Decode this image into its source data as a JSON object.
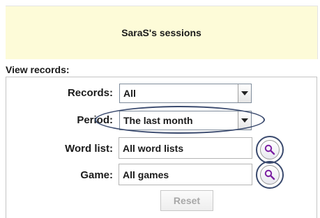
{
  "header": {
    "title": "SaraS's sessions"
  },
  "view_records": {
    "label": "View records:",
    "records": {
      "label": "Records:",
      "value": "All"
    },
    "period": {
      "label": "Period:",
      "value": "The last month"
    },
    "word_list": {
      "label": "Word list:",
      "value": "All word lists"
    },
    "game": {
      "label": "Game:",
      "value": "All games"
    },
    "reset_label": "Reset"
  },
  "icons": {
    "dropdown": "chevron-down-icon",
    "search": "magnifier-icon",
    "search_color": "#7b1fa2"
  },
  "colors": {
    "header_bg": "#fdfbd8",
    "highlight_ring": "#3a4a6e",
    "disabled_text": "#a8a8a8"
  }
}
